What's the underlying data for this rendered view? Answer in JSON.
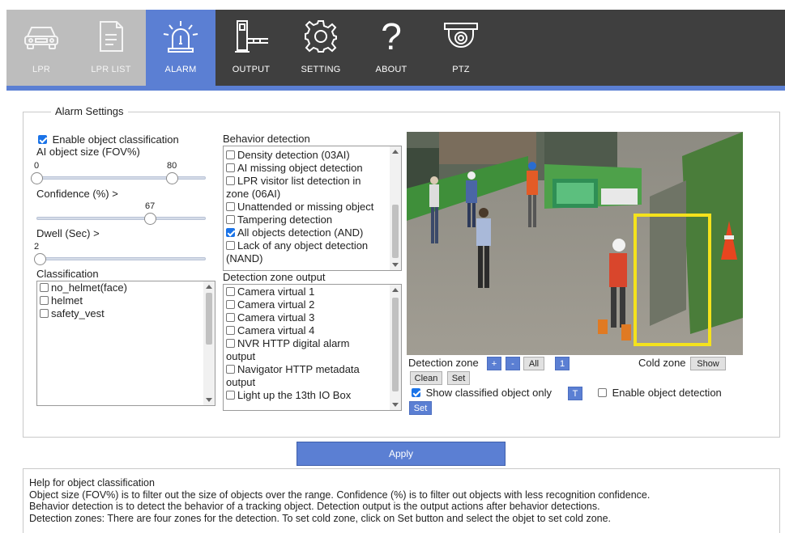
{
  "nav": {
    "items": [
      {
        "label": "LPR",
        "icon": "car-icon"
      },
      {
        "label": "LPR LIST",
        "icon": "document-list-icon"
      },
      {
        "label": "ALARM",
        "icon": "alarm-light-icon"
      },
      {
        "label": "OUTPUT",
        "icon": "output-gate-icon"
      },
      {
        "label": "SETTING",
        "icon": "gear-icon"
      },
      {
        "label": "ABOUT",
        "icon": "question-icon"
      },
      {
        "label": "PTZ",
        "icon": "ptz-camera-icon"
      }
    ],
    "active": "ALARM",
    "colors": {
      "bar": "#3f3f3f",
      "active": "#5b7fd3",
      "dim": "#bdbdbd"
    }
  },
  "alarm_settings": {
    "legend": "Alarm Settings",
    "enable_classification": {
      "label": "Enable object classification",
      "checked": true
    },
    "object_size": {
      "label": "AI object size (FOV%)",
      "min_value": "0",
      "max_value": "80",
      "low": 0,
      "high": 80,
      "range_max": 100
    },
    "confidence": {
      "label": "Confidence (%) >",
      "value": "67",
      "level": 67
    },
    "dwell": {
      "label": "Dwell (Sec) >",
      "value": "2",
      "level": 2
    },
    "classification": {
      "label": "Classification",
      "items": [
        {
          "label": "no_helmet(face)",
          "checked": false
        },
        {
          "label": "helmet",
          "checked": false
        },
        {
          "label": "safety_vest",
          "checked": false
        }
      ]
    },
    "behavior": {
      "label": "Behavior detection",
      "items": [
        {
          "label": "Density detection (03AI)",
          "checked": false
        },
        {
          "label": "AI missing object detection",
          "checked": false
        },
        {
          "label": "LPR visitor list detection in",
          "cont": "zone (06AI)",
          "checked": false
        },
        {
          "label": "Unattended or missing object",
          "checked": false
        },
        {
          "label": "Tampering detection",
          "checked": false
        },
        {
          "label": "All objects detection (AND)",
          "checked": true
        },
        {
          "label": "Lack of any object detection",
          "cont": "(NAND)",
          "checked": false
        }
      ]
    },
    "zone_output": {
      "label": "Detection zone output",
      "items": [
        {
          "label": "Camera virtual 1",
          "checked": false
        },
        {
          "label": "Camera virtual 2",
          "checked": false
        },
        {
          "label": "Camera virtual 3",
          "checked": false
        },
        {
          "label": "Camera virtual 4",
          "checked": false
        },
        {
          "label": "NVR HTTP digital alarm",
          "cont": "output",
          "checked": false
        },
        {
          "label": "Navigator HTTP metadata",
          "cont": "output",
          "checked": false
        },
        {
          "label": "Light up the 13th IO Box",
          "checked": false
        }
      ]
    },
    "detection_zone": {
      "label": "Detection zone",
      "plus": "+",
      "minus": "-",
      "all": "All",
      "zone_number": "1",
      "clean": "Clean",
      "set": "Set",
      "cold_zone_label": "Cold zone",
      "show": "Show",
      "show_classified": {
        "label": "Show classified object only",
        "checked": true
      },
      "t_button": "T",
      "enable_object_detection": {
        "label": "Enable object detection",
        "checked": false
      },
      "set2": "Set"
    }
  },
  "apply_label": "Apply",
  "help": {
    "lines": [
      "Help for object classification",
      "Object size (FOV%) is to filter out the size of objects over the range. Confidence (%) is to filter out objects with less recognition confidence.",
      "Behavior detection is to detect the behavior of a tracking object. Detection output is the output actions after behavior detections.",
      "Detection zones: There are four zones for the detection. To set cold zone, click on Set button and select the objet to set cold zone."
    ]
  }
}
